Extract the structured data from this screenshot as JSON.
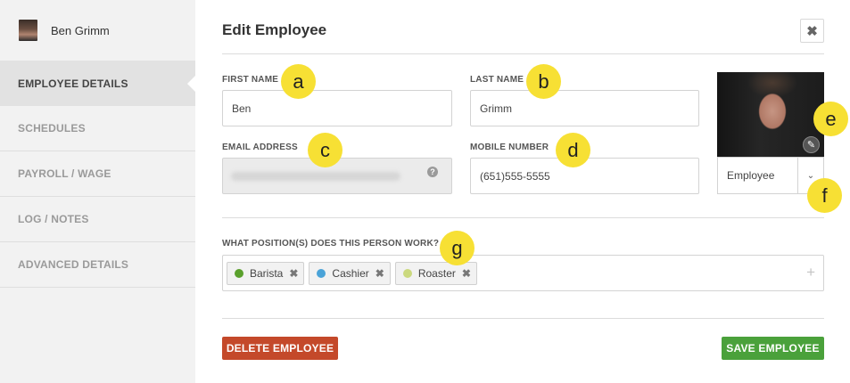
{
  "user": {
    "name": "Ben Grimm"
  },
  "sidebar": {
    "items": [
      {
        "label": "EMPLOYEE DETAILS",
        "active": true
      },
      {
        "label": "SCHEDULES"
      },
      {
        "label": "PAYROLL / WAGE"
      },
      {
        "label": "LOG / NOTES"
      },
      {
        "label": "ADVANCED DETAILS"
      }
    ]
  },
  "header": {
    "title": "Edit Employee",
    "close_icon": "close-icon"
  },
  "form": {
    "first_name": {
      "label": "FIRST NAME",
      "value": "Ben"
    },
    "last_name": {
      "label": "LAST NAME",
      "value": "Grimm"
    },
    "email": {
      "label": "EMAIL ADDRESS",
      "value": ""
    },
    "mobile": {
      "label": "MOBILE NUMBER",
      "value": "(651)555-5555"
    },
    "role": {
      "value": "Employee"
    },
    "positions": {
      "label": "WHAT POSITION(S) DOES THIS PERSON WORK?",
      "tags": [
        {
          "name": "Barista",
          "color": "#5aa02c"
        },
        {
          "name": "Cashier",
          "color": "#4aa3d8"
        },
        {
          "name": "Roaster",
          "color": "#cbd97e"
        }
      ]
    }
  },
  "actions": {
    "delete_label": "DELETE EMPLOYEE",
    "save_label": "SAVE EMPLOYEE"
  },
  "markers": [
    "a",
    "b",
    "c",
    "d",
    "e",
    "f",
    "g"
  ],
  "colors": {
    "delete": "#c4492a",
    "save": "#4aa13b",
    "marker": "#f7e034"
  }
}
